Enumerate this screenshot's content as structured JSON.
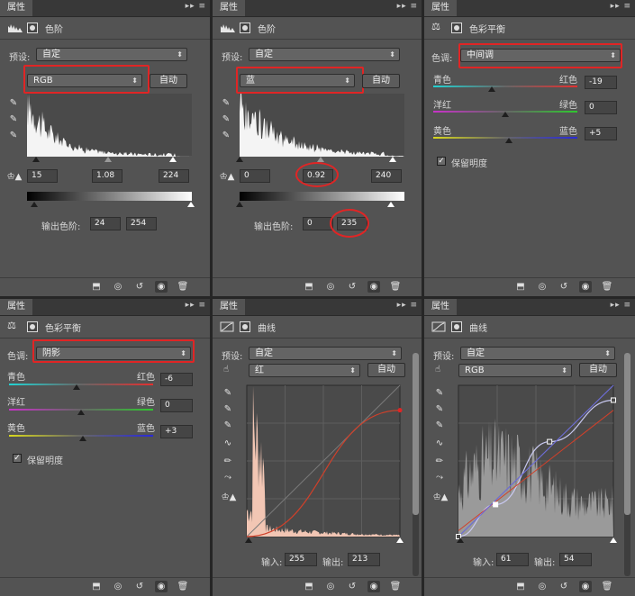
{
  "panels": {
    "p1": {
      "tab": "属性",
      "header_title": "色阶",
      "preset_label": "预设:",
      "preset_value": "自定",
      "channel_value": "RGB",
      "auto_label": "自动",
      "input_black": "15",
      "input_gamma": "1.08",
      "input_white": "224",
      "output_label": "输出色阶:",
      "output_black": "24",
      "output_white": "254"
    },
    "p2": {
      "tab": "属性",
      "header_title": "色阶",
      "preset_label": "预设:",
      "preset_value": "自定",
      "channel_value": "蓝",
      "auto_label": "自动",
      "input_black": "0",
      "input_gamma": "0.92",
      "input_white": "240",
      "output_label": "输出色阶:",
      "output_black": "0",
      "output_white": "235"
    },
    "p3": {
      "tab": "属性",
      "header_title": "色彩平衡",
      "tone_label": "色调:",
      "tone_value": "中间调",
      "rows": [
        {
          "left": "青色",
          "right": "红色",
          "value": "-19",
          "level": -19
        },
        {
          "left": "洋红",
          "right": "绿色",
          "value": "0",
          "level": 0
        },
        {
          "left": "黄色",
          "right": "蓝色",
          "value": "+5",
          "level": 5
        }
      ],
      "preserve_label": "保留明度",
      "preserve_checked": true
    },
    "p4": {
      "tab": "属性",
      "header_title": "色彩平衡",
      "tone_label": "色调:",
      "tone_value": "阴影",
      "rows": [
        {
          "left": "青色",
          "right": "红色",
          "value": "-6",
          "level": -6
        },
        {
          "left": "洋红",
          "right": "绿色",
          "value": "0",
          "level": 0
        },
        {
          "left": "黄色",
          "right": "蓝色",
          "value": "+3",
          "level": 3
        }
      ],
      "preserve_label": "保留明度",
      "preserve_checked": true
    },
    "p5": {
      "tab": "属性",
      "header_title": "曲线",
      "preset_label": "预设:",
      "preset_value": "自定",
      "channel_value": "红",
      "auto_label": "自动",
      "input_label": "输入:",
      "input_value": "255",
      "output_label": "输出:",
      "output_value": "213"
    },
    "p6": {
      "tab": "属性",
      "header_title": "曲线",
      "preset_label": "预设:",
      "preset_value": "自定",
      "channel_value": "RGB",
      "auto_label": "自动",
      "input_label": "输入:",
      "input_value": "61",
      "output_label": "输出:",
      "output_value": "54"
    }
  },
  "tab_controls": "▸▸ ≡",
  "footer_icons": [
    "clip-to-layer-icon",
    "view-previous-icon",
    "reset-icon",
    "visibility-eye-icon",
    "trash-icon"
  ],
  "colors": {
    "accent_red": "#e02525",
    "panel_bg": "#535353",
    "curve_red": "#d0402a",
    "curve_blue": "#8a8ae8"
  }
}
